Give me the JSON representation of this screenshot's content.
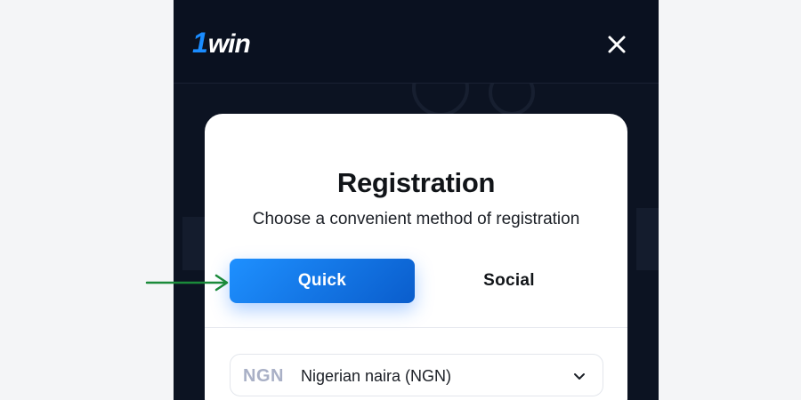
{
  "header": {
    "logo_prefix": "1",
    "logo_text": "win"
  },
  "modal": {
    "title": "Registration",
    "subtitle": "Choose a convenient method of registration"
  },
  "tabs": [
    {
      "label": "Quick",
      "active": true
    },
    {
      "label": "Social",
      "active": false
    }
  ],
  "currency": {
    "code": "NGN",
    "name": "Nigerian naira (NGN)"
  },
  "colors": {
    "accent": "#1a8cff",
    "background": "#0c1322",
    "arrow": "#1a8a3a"
  },
  "icons": {
    "close": "close-icon",
    "chevron": "chevron-down-icon",
    "arrow": "arrow-right-icon"
  }
}
